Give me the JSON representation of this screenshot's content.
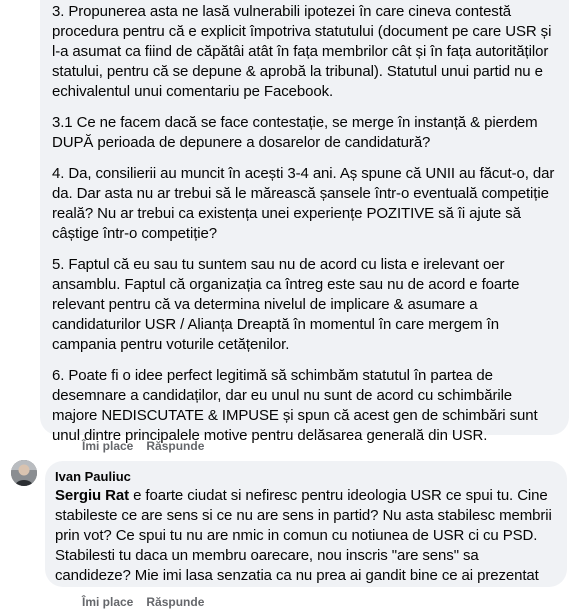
{
  "comment1": {
    "paragraphs": [
      "3. Propunerea asta ne lasă vulnerabili ipotezei în care cineva contestă procedura pentru că e explicit împotriva statutului (document pe care USR și l-a asumat ca fiind de căpătâi atât în fața membrilor cât și în fața autorităților statului, pentru că se depune & aprobă la tribunal). Statutul unui partid nu e echivalentul unui comentariu pe Facebook.",
      "3.1 Ce ne facem dacă se face contestație, se merge în instanță & pierdem DUPĂ perioada de depunere a dosarelor de candidatură?",
      "4. Da, consilierii au muncit în acești 3-4 ani. Aș spune că UNII au făcut-o, dar da. Dar asta nu ar trebui să le mărească șansele într-o eventuală competiție reală? Nu ar trebui ca existența unei experiențe POZITIVE să îi ajute să câștige într-o competiție?",
      "5. Faptul că eu sau tu suntem sau nu de acord cu lista e irelevant oer ansamblu. Faptul că organizația ca întreg este sau nu de acord e foarte relevant pentru că va determina nivelul de implicare & asumare a candidaturilor USR / Alianța Dreaptă în momentul în care mergem în campania pentru voturile cetățenilor.",
      "6. Poate fi o idee perfect legitimă să schimbăm statutul în partea de desemnare a candidaților, dar eu unul nu sunt de acord cu schimbările majore NEDISCUTATE & IMPUSE și spun că acest gen de schimbări sunt unul dintre principalele motive pentru delăsarea generală din USR."
    ],
    "like_label": "Îmi place",
    "reply_label": "Răspunde"
  },
  "comment2": {
    "author": "Ivan Pauliuc",
    "mention": "Sergiu Rat",
    "text": " e foarte ciudat si nefiresc pentru ideologia USR ce spui tu. Cine stabileste ce are sens si ce nu are sens in partid? Nu asta stabilesc membrii prin vot? Ce spui tu nu are nmic in comun cu notiunea de USR ci cu PSD. Stabilesti tu daca un membru oarecare, nou inscris \"are sens\" sa candideze? Mie imi lasa senzatia ca nu prea ai gandit bine ce ai prezentat",
    "like_label": "Îmi place",
    "reply_label": "Răspunde"
  }
}
